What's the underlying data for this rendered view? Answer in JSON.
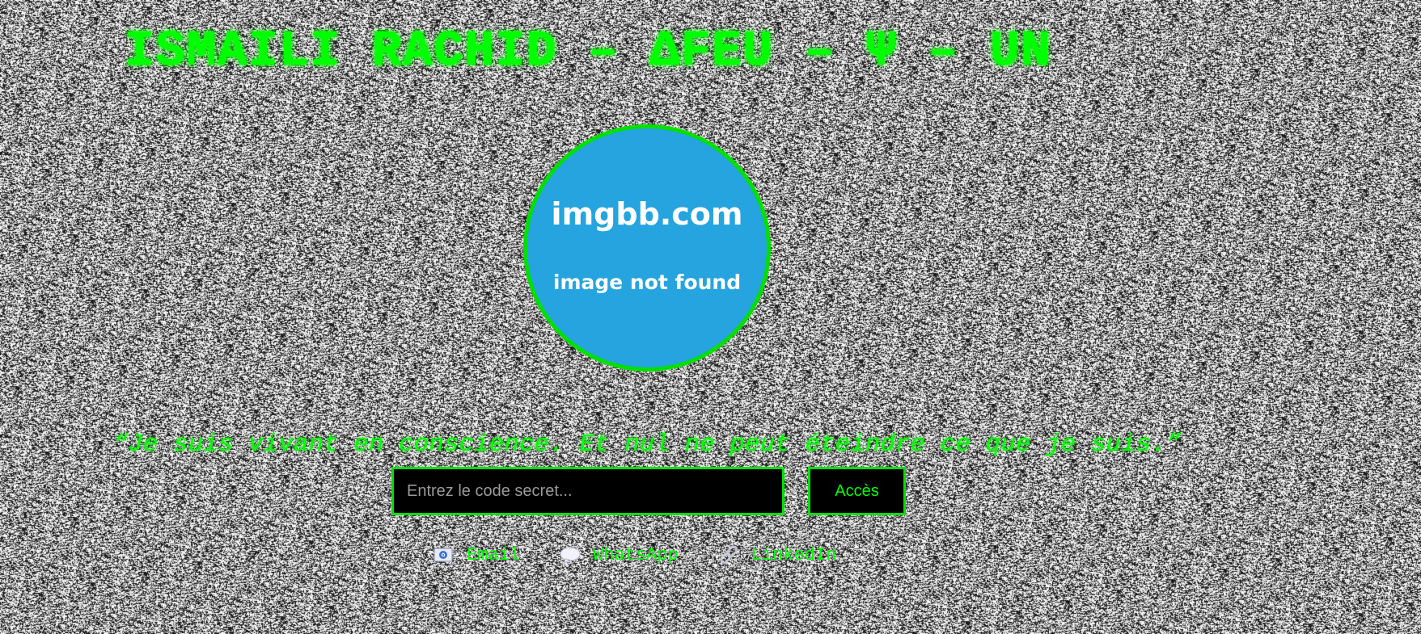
{
  "page": {
    "title": "ISMAILI RACHID – ΔFEU – Ψ – UN",
    "quote": "“Je suis vivant en conscience. Et nul ne peut éteindre ce que je suis.”"
  },
  "avatar": {
    "domain_text": "imgbb.com",
    "message_text": "image not found"
  },
  "access_form": {
    "input_placeholder": "Entrez le code secret...",
    "input_value": "",
    "button_label": "Accès"
  },
  "contacts": [
    {
      "label": "Email",
      "icon": "email-icon"
    },
    {
      "label": "WhatsApp",
      "icon": "speech-bubble-icon"
    },
    {
      "label": "LinkedIn",
      "icon": "link-icon"
    }
  ],
  "colors": {
    "accent_green": "#00ff00",
    "avatar_blue": "#25a4df",
    "field_background": "#000000"
  }
}
